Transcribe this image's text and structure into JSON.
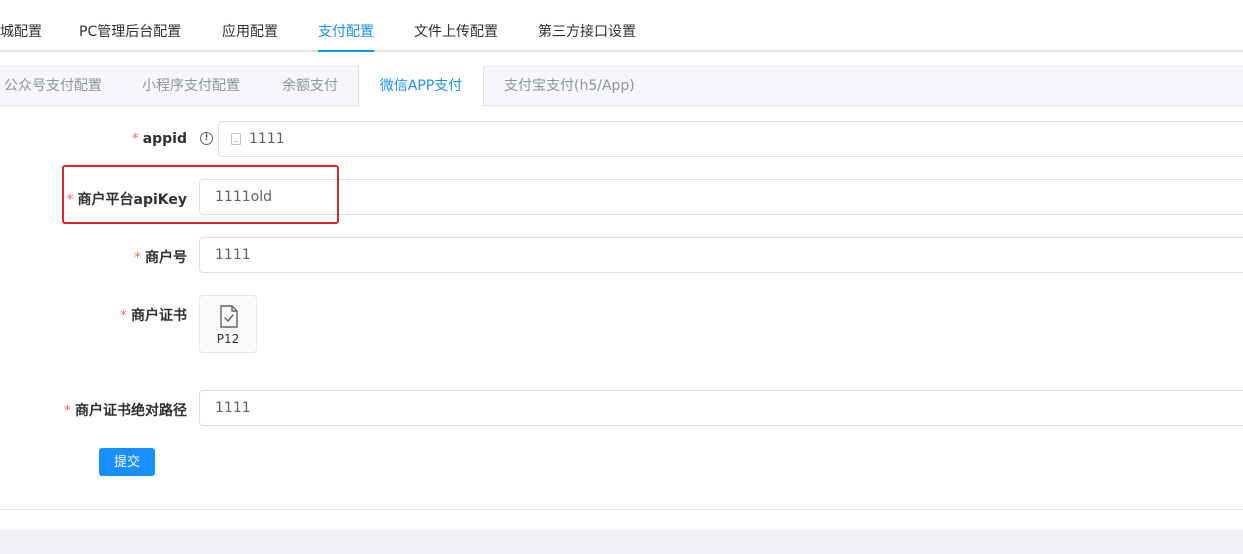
{
  "top_tabs": [
    {
      "label": "城配置"
    },
    {
      "label": "PC管理后台配置"
    },
    {
      "label": "应用配置"
    },
    {
      "label": "支付配置"
    },
    {
      "label": "文件上传配置"
    },
    {
      "label": "第三方接口设置"
    }
  ],
  "top_tabs_active": "支付配置",
  "sub_tabs": [
    {
      "label": "公众号支付配置"
    },
    {
      "label": "小程序支付配置"
    },
    {
      "label": "余额支付"
    },
    {
      "label": "微信APP支付"
    },
    {
      "label": "支付宝支付(h5/App)"
    }
  ],
  "sub_tabs_active": "微信APP支付",
  "form": {
    "required_mark": "*",
    "appid": {
      "label": "appid",
      "value": "1111",
      "info_icon": "!"
    },
    "api_key": {
      "label": "商户平台apiKey",
      "value": "1111old"
    },
    "merchant_no": {
      "label": "商户号",
      "value": "1111"
    },
    "certificate": {
      "label": "商户证书",
      "file_label": "P12"
    },
    "cert_path": {
      "label": "商户证书绝对路径",
      "value": "1111"
    },
    "submit_label": "提交"
  },
  "colors": {
    "accent": "#1890ff",
    "required": "#f56c6c",
    "highlight_box": "#e0262a"
  },
  "icons": {
    "info": "info-circle-icon",
    "input_prefix": "document-icon",
    "file": "file-check-icon"
  }
}
